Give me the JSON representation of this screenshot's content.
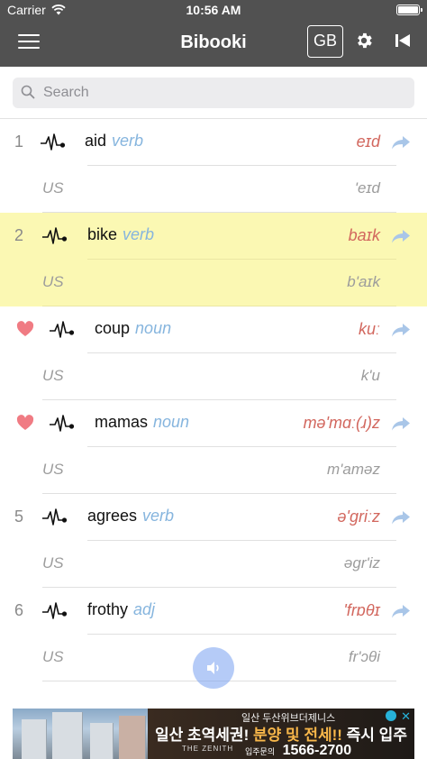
{
  "status_bar": {
    "carrier": "Carrier",
    "time": "10:56 AM"
  },
  "nav": {
    "title": "Bibooki",
    "gb_label": "GB"
  },
  "search": {
    "placeholder": "Search"
  },
  "entries": [
    {
      "index": "1",
      "favorite": false,
      "word": "aid",
      "pos": "verb",
      "ipa_gb": "eɪd",
      "region": "US",
      "ipa_us": "'eɪd",
      "highlighted": false
    },
    {
      "index": "2",
      "favorite": false,
      "word": "bike",
      "pos": "verb",
      "ipa_gb": "baɪk",
      "region": "US",
      "ipa_us": "b'aɪk",
      "highlighted": true
    },
    {
      "index": "",
      "favorite": true,
      "word": "coup",
      "pos": "noun",
      "ipa_gb": "kuː",
      "region": "US",
      "ipa_us": "k'u",
      "highlighted": false
    },
    {
      "index": "",
      "favorite": true,
      "word": "mamas",
      "pos": "noun",
      "ipa_gb": "mə'mɑː(ɹ)z",
      "region": "US",
      "ipa_us": "m'aməz",
      "highlighted": false
    },
    {
      "index": "5",
      "favorite": false,
      "word": "agrees",
      "pos": "verb",
      "ipa_gb": "ə'griːz",
      "region": "US",
      "ipa_us": "əgr'iz",
      "highlighted": false
    },
    {
      "index": "6",
      "favorite": false,
      "word": "frothy",
      "pos": "adj",
      "ipa_gb": "'frɒθɪ",
      "region": "US",
      "ipa_us": "fr'ɔθi",
      "highlighted": false
    }
  ],
  "ad": {
    "line1": "일산 두산위브더제니스",
    "line2_a": "일산 초역세권!",
    "line2_b": "분양 및 전세!!",
    "line2_c": "즉시 입주",
    "logo": "THE ZENITH",
    "line3_small": "입주문의",
    "phone": "1566-2700"
  },
  "colors": {
    "nav": "#515151",
    "highlight": "#fbf8b3",
    "ipa": "#d2675e",
    "pos": "#86b5de",
    "heart": "#f07b83"
  }
}
